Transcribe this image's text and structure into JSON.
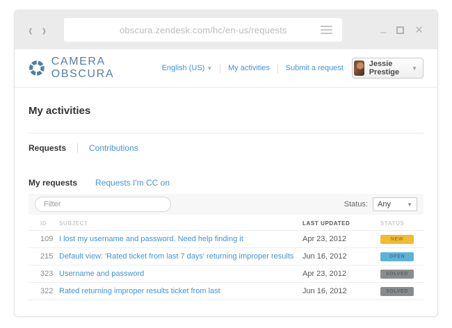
{
  "browser": {
    "url": "obscura.zendesk.com/hc/en-us/requests",
    "back_glyph": "‹",
    "forward_glyph": "›",
    "minimize_glyph": "–",
    "close_glyph": "✕"
  },
  "header": {
    "brand": "CAMERA OBSCURA",
    "nav": {
      "language": "English (US)",
      "my_activities": "My activities",
      "submit_request": "Submit a request",
      "user_name": "Jessie Prestige",
      "caret": "▼"
    }
  },
  "page": {
    "title": "My activities",
    "tabs": {
      "requests": "Requests",
      "contributions": "Contributions"
    },
    "subtabs": {
      "my_requests": "My requests",
      "cc": "Requests I'm CC on"
    },
    "filter_placeholder": "Filter",
    "status_label": "Status:",
    "status_value": "Any",
    "status_caret": "▼"
  },
  "table": {
    "headers": {
      "id": "ID",
      "subject": "SUBJECT",
      "updated": "LAST UPDATED",
      "status": "STATUS"
    },
    "rows": [
      {
        "id": "109",
        "subject": "I lost my username and password. Need help finding it",
        "updated": "Apr 23, 2012",
        "status": "NEW",
        "status_color": "#f2bb30"
      },
      {
        "id": "215",
        "subject": "Default view: 'Rated ticket from last 7 days' returning improper results",
        "updated": "Jun 16, 2012",
        "status": "OPEN",
        "status_color": "#5cb2d9"
      },
      {
        "id": "323",
        "subject": "Username and password",
        "updated": "Apr 23, 2012",
        "status": "SOLVED",
        "status_color": "#898b8d"
      },
      {
        "id": "322",
        "subject": "Rated  returning improper results ticket from last",
        "updated": "Jun 16, 2012",
        "status": "SOLVED",
        "status_color": "#898b8d"
      }
    ]
  },
  "colors": {
    "accent_link": "#4193d6",
    "brand_blue": "#4e7ea6",
    "badge_new": "#f2bb30",
    "badge_open": "#5cb2d9",
    "badge_solved": "#898b8d"
  }
}
